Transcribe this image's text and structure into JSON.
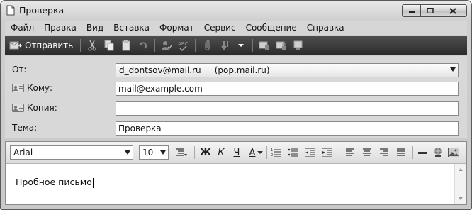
{
  "window": {
    "title": "Проверка"
  },
  "menu": [
    "Файл",
    "Правка",
    "Вид",
    "Вставка",
    "Формат",
    "Сервис",
    "Сообщение",
    "Справка"
  ],
  "toolbar": {
    "send_label": "Отправить"
  },
  "headers": {
    "from_label": "От:",
    "from_value": "d_dontsov@mail.ru     (pop.mail.ru)",
    "to_label": "Кому:",
    "to_value": "mail@example.com",
    "cc_label": "Копия:",
    "cc_value": "",
    "subject_label": "Тема:",
    "subject_value": "Проверка"
  },
  "format": {
    "font": "Arial",
    "size": "10",
    "bold": "Ж",
    "italic": "К",
    "underline": "Ч",
    "color": "A"
  },
  "body": {
    "text": "Пробное письмо"
  }
}
